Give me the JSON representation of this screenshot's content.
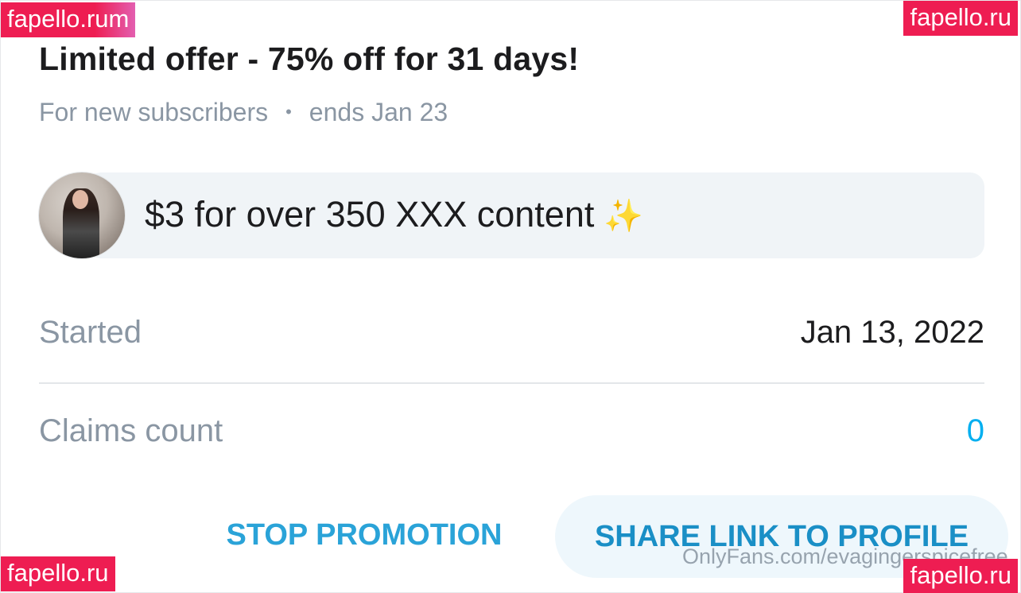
{
  "offer": {
    "title": "Limited offer - 75% off for 31 days!",
    "audience": "For new subscribers",
    "separator": "•",
    "ends": "ends Jan 23"
  },
  "message": {
    "text": "$3 for over 350 XXX content",
    "emoji": "✨",
    "avatar_icon": "user-avatar-photo"
  },
  "details": {
    "started_label": "Started",
    "started_value": "Jan 13, 2022",
    "claims_label": "Claims count",
    "claims_value": "0"
  },
  "actions": {
    "stop_label": "STOP PROMOTION",
    "share_label": "SHARE LINK TO PROFILE"
  },
  "watermarks": {
    "top_left": "fapello.rum",
    "top_right": "fapello.ru",
    "bottom_left": "fapello.ru",
    "bottom_right": "fapello.ru",
    "site_text": "OnlyFans.com/evagingerspicefree"
  },
  "colors": {
    "accent": "#00aff0",
    "muted_text": "#8a96a3",
    "bubble_bg": "#f0f4f7",
    "watermark_bg": "#ee1d52"
  }
}
